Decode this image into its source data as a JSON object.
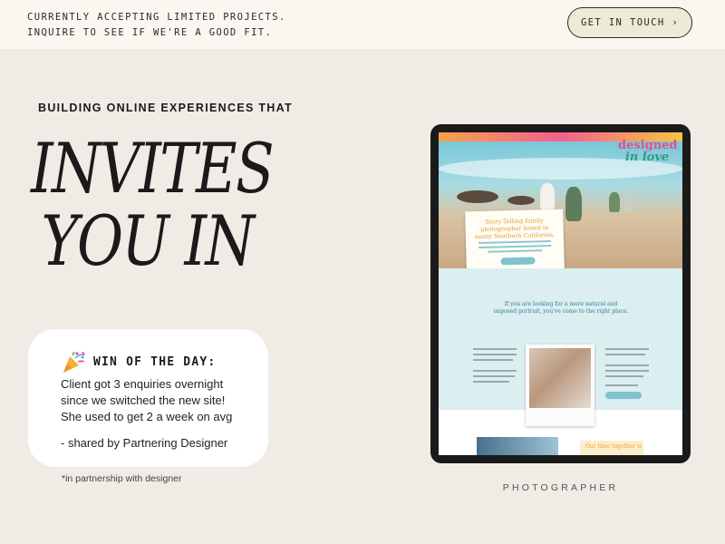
{
  "announcement": {
    "line1": "CURRENTLY ACCEPTING LIMITED PROJECTS.",
    "line2": "INQUIRE TO SEE IF WE'RE A GOOD FIT."
  },
  "header": {
    "cta_label": "GET IN TOUCH ›"
  },
  "hero": {
    "kicker": "BUILDING ONLINE EXPERIENCES THAT",
    "headline_line1": "INVITES",
    "headline_line2": "YOU IN"
  },
  "win_card": {
    "icon": "party-popper-icon",
    "title": "WIN OF THE DAY:",
    "body_lines": [
      "Client got 3 enquiries overnight",
      "since we switched the new site!",
      "She used to get 2 a week on avg"
    ],
    "attribution": "- shared by Partnering Designer",
    "footnote": "*in partnership with designer"
  },
  "showcase": {
    "logo_line1": "designed",
    "logo_line2": "in love",
    "paper_title": "Story-Telling family photographer based in sunny Southern California.",
    "intro_text": "If you are looking for a more natural and unposed portrait, you've come to the right place.",
    "bottom_card_text": "Our time together is",
    "caption": "PHOTOGRAPHER"
  },
  "colors": {
    "background": "#f0ebe4",
    "topbar": "#faf7f1",
    "cta_fill": "#ecebd6",
    "card": "#ffffff"
  }
}
